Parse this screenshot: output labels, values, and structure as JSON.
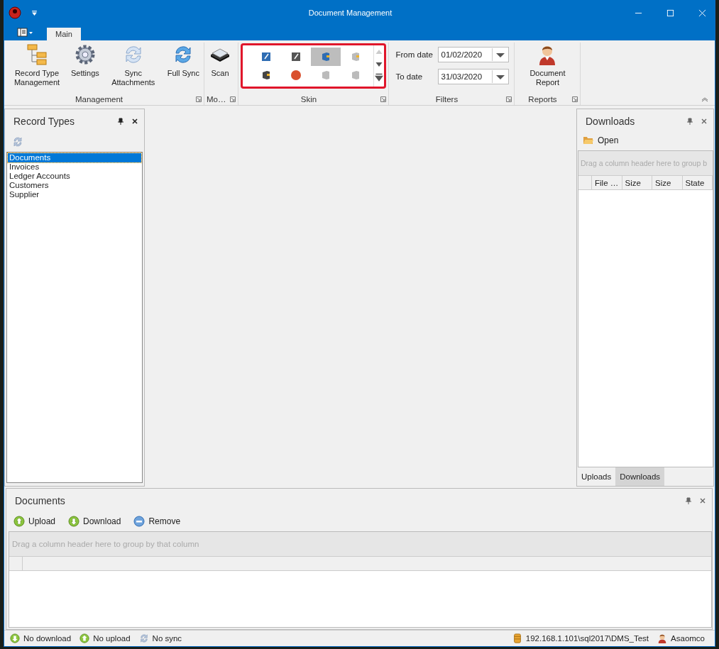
{
  "window": {
    "title": "Document Management"
  },
  "ribbon": {
    "tabs": [
      {
        "label": "Main",
        "selected": true
      }
    ],
    "groups": [
      {
        "kind": "buttons",
        "label": "Management",
        "buttons": [
          {
            "label": "Record Type Management",
            "kind": "tree"
          },
          {
            "label": "Settings",
            "kind": "gear"
          },
          {
            "label": "Sync Attachments",
            "kind": "sync"
          },
          {
            "label": "Full Sync",
            "kind": "fullsync"
          }
        ]
      },
      {
        "kind": "buttons",
        "label": "Mo…",
        "buttons": [
          {
            "label": "Scan",
            "kind": "scanner"
          }
        ]
      },
      {
        "kind": "gallery",
        "label": "Skin",
        "items": [
          {
            "selected": false
          },
          {
            "selected": false
          },
          {
            "selected": true
          },
          {
            "selected": false
          },
          {
            "selected": false
          },
          {
            "selected": false
          },
          {
            "selected": false
          },
          {
            "selected": false
          }
        ]
      },
      {
        "kind": "filters",
        "label": "Filters",
        "fields": [
          {
            "label": "From date",
            "value": "01/02/2020"
          },
          {
            "label": "To date",
            "value": "31/03/2020"
          }
        ]
      },
      {
        "kind": "buttons",
        "label": "Reports",
        "buttons": [
          {
            "label": "Document Report",
            "kind": "person"
          }
        ]
      }
    ]
  },
  "record_types": {
    "title": "Record Types",
    "items": [
      {
        "label": "Documents",
        "selected": true
      },
      {
        "label": "Invoices",
        "selected": false
      },
      {
        "label": "Ledger Accounts",
        "selected": false
      },
      {
        "label": "Customers",
        "selected": false
      },
      {
        "label": "Supplier",
        "selected": false
      }
    ]
  },
  "downloads": {
    "title": "Downloads",
    "open_button": "Open",
    "group_panel": "Drag a column header here to group b",
    "columns": [
      "File …",
      "Size",
      "Size",
      "State"
    ],
    "tabs": [
      {
        "label": "Uploads",
        "selected": false
      },
      {
        "label": "Downloads",
        "selected": true
      }
    ]
  },
  "documents": {
    "title": "Documents",
    "actions": [
      {
        "label": "Upload",
        "kind": "up"
      },
      {
        "label": "Download",
        "kind": "down"
      },
      {
        "label": "Remove",
        "kind": "remove"
      }
    ],
    "group_panel": "Drag a column header here to group by that column"
  },
  "status_bar": {
    "left": [
      {
        "label": "No download",
        "kind": "down"
      },
      {
        "label": "No upload",
        "kind": "up"
      },
      {
        "label": "No sync",
        "kind": "sync"
      }
    ],
    "right": [
      {
        "label": "192.168.1.101\\sql2017\\DMS_Test",
        "kind": "db"
      },
      {
        "label": "Asaomco",
        "kind": "user"
      }
    ]
  }
}
